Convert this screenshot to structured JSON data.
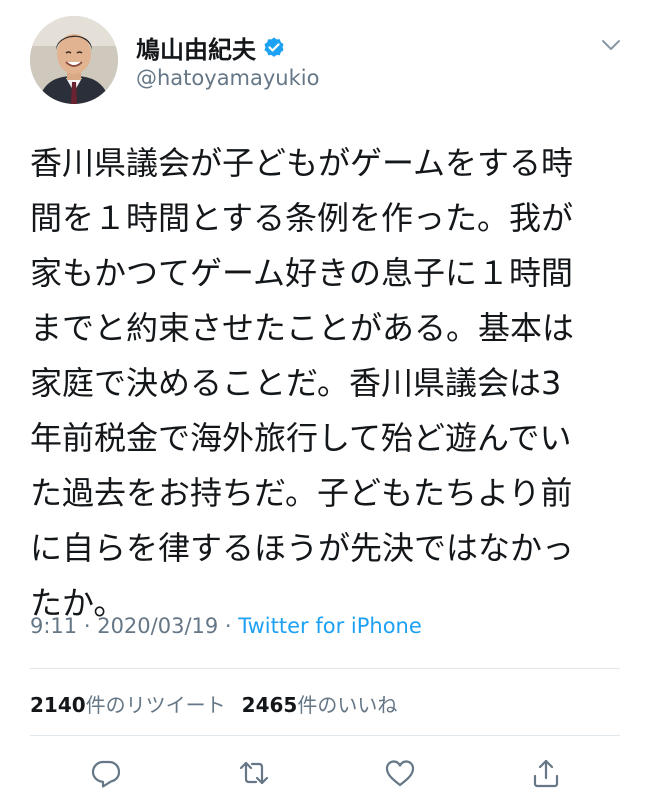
{
  "user": {
    "display_name": "鳩山由紀夫",
    "handle": "@hatoyamayukio"
  },
  "tweet": {
    "lines": [
      "香川県議会が子どもがゲームをする時",
      "間を１時間とする条例を作った。我が",
      "家もかつてゲーム好きの息子に１時間",
      "までと約束させたことがある。基本は",
      "家庭で決めることだ。香川県議会は3",
      "年前税金で海外旅行して殆ど遊んでい",
      "た過去をお持ちだ。子どもたちより前",
      "に自らを律するほうが先決ではなかっ",
      "たか。"
    ],
    "time": "9:11",
    "separator1": " · ",
    "date": "2020/03/19",
    "separator2": " · ",
    "source": "Twitter for iPhone"
  },
  "stats": {
    "retweets_count": "2140",
    "retweets_label": "件のリツイート",
    "likes_count": "2465",
    "likes_label": "件のいいね"
  },
  "icons": {
    "verified": "verified-badge-icon",
    "more": "chevron-down-icon",
    "reply": "reply-icon",
    "retweet": "retweet-icon",
    "like": "heart-icon",
    "share": "share-icon"
  },
  "colors": {
    "text": "#14171a",
    "secondary": "#657786",
    "link": "#1da1f2",
    "verified": "#1da1f2",
    "divider": "#e1e8ed",
    "action_icon": "#657786"
  }
}
